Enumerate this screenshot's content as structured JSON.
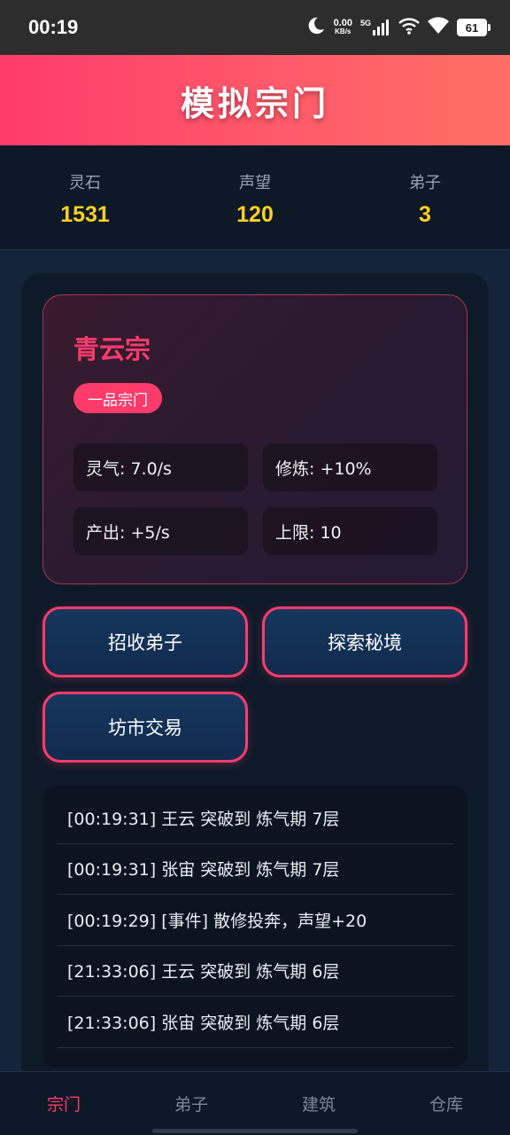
{
  "status_bar": {
    "time": "00:19",
    "net_speed_value": "0.00",
    "net_speed_unit": "KB/s",
    "signal_label": "5G",
    "battery": "61"
  },
  "header": {
    "title": "模拟宗门"
  },
  "stats": [
    {
      "label": "灵石",
      "value": "1531"
    },
    {
      "label": "声望",
      "value": "120"
    },
    {
      "label": "弟子",
      "value": "3"
    }
  ],
  "sect": {
    "name": "青云宗",
    "rank": "一品宗门",
    "attributes": [
      "灵气: 7.0/s",
      "修炼: +10%",
      "产出: +5/s",
      "上限: 10"
    ]
  },
  "actions": {
    "recruit_label": "招收弟子",
    "explore_label": "探索秘境",
    "market_label": "坊市交易"
  },
  "log": [
    "[00:19:31] 王云 突破到 炼气期 7层",
    "[00:19:31] 张宙 突破到 炼气期 7层",
    "[00:19:29] [事件] 散修投奔，声望+20",
    "[21:33:06] 王云 突破到 炼气期 6层",
    "[21:33:06] 张宙 突破到 炼气期 6层"
  ],
  "nav": [
    {
      "label": "宗门",
      "active": true
    },
    {
      "label": "弟子",
      "active": false
    },
    {
      "label": "建筑",
      "active": false
    },
    {
      "label": "仓库",
      "active": false
    }
  ],
  "colors": {
    "accent": "#ff3b6b",
    "gold": "#ffd21f",
    "button_bg": "#15365e"
  }
}
